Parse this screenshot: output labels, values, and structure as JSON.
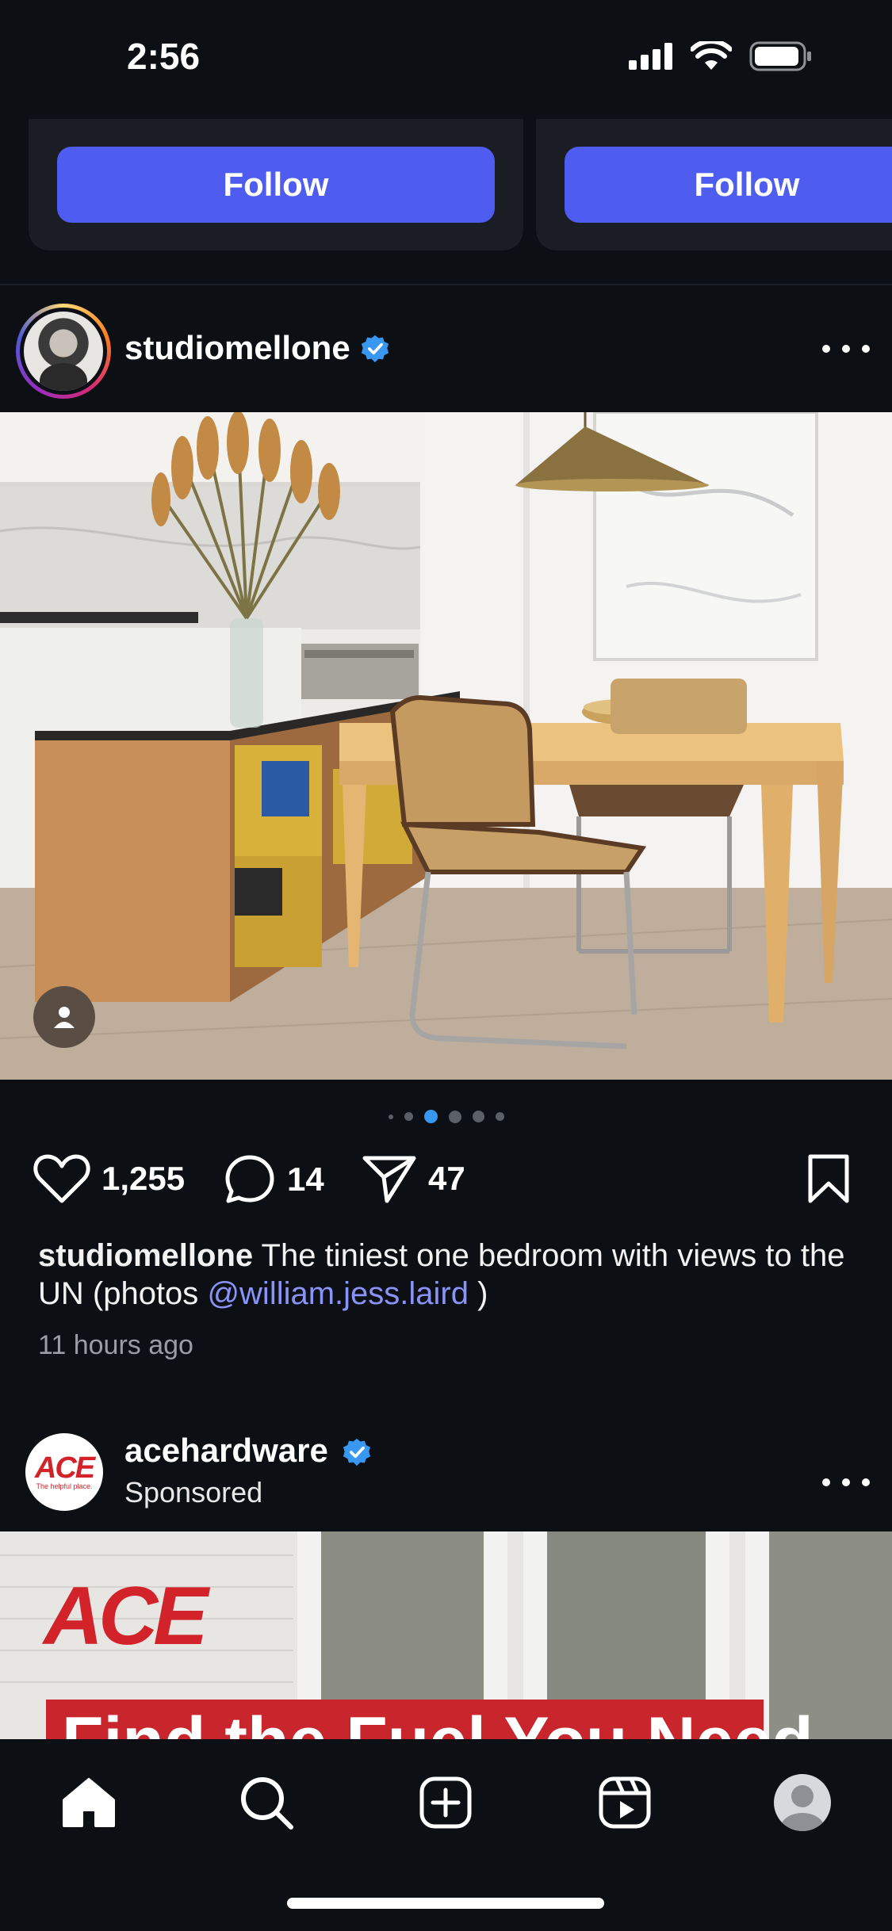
{
  "status_bar": {
    "time": "2:56"
  },
  "suggestions": {
    "follow_label": "Follow"
  },
  "post": {
    "username": "studiomellone",
    "verified": true,
    "likes": "1,255",
    "comments": "14",
    "shares": "47",
    "caption": {
      "username": "studiomellone",
      "text": "The tiniest one bedroom with views to the UN (photos",
      "mention": "@william.jess.laird",
      "tail": ")"
    },
    "timestamp": "11 hours ago",
    "carousel": {
      "count": 6,
      "active_index": 2
    }
  },
  "ad": {
    "username": "acehardware",
    "verified": true,
    "sponsored_label": "Sponsored",
    "logo_text": "ACE",
    "logo_tagline": "The helpful place.",
    "image_logo_text": "ACE",
    "banner_text": "Find the Fuel You Need"
  },
  "tab_bar": {
    "tabs": [
      "home-icon",
      "search-icon",
      "create-icon",
      "reels-icon",
      "profile-icon"
    ]
  },
  "colors": {
    "background": "#0c0f14",
    "follow_button": "#4f5cf0",
    "link": "#8a93f7",
    "verified_badge": "#3897f0",
    "carousel_active": "#3897f0",
    "ace_red": "#d2232a"
  }
}
